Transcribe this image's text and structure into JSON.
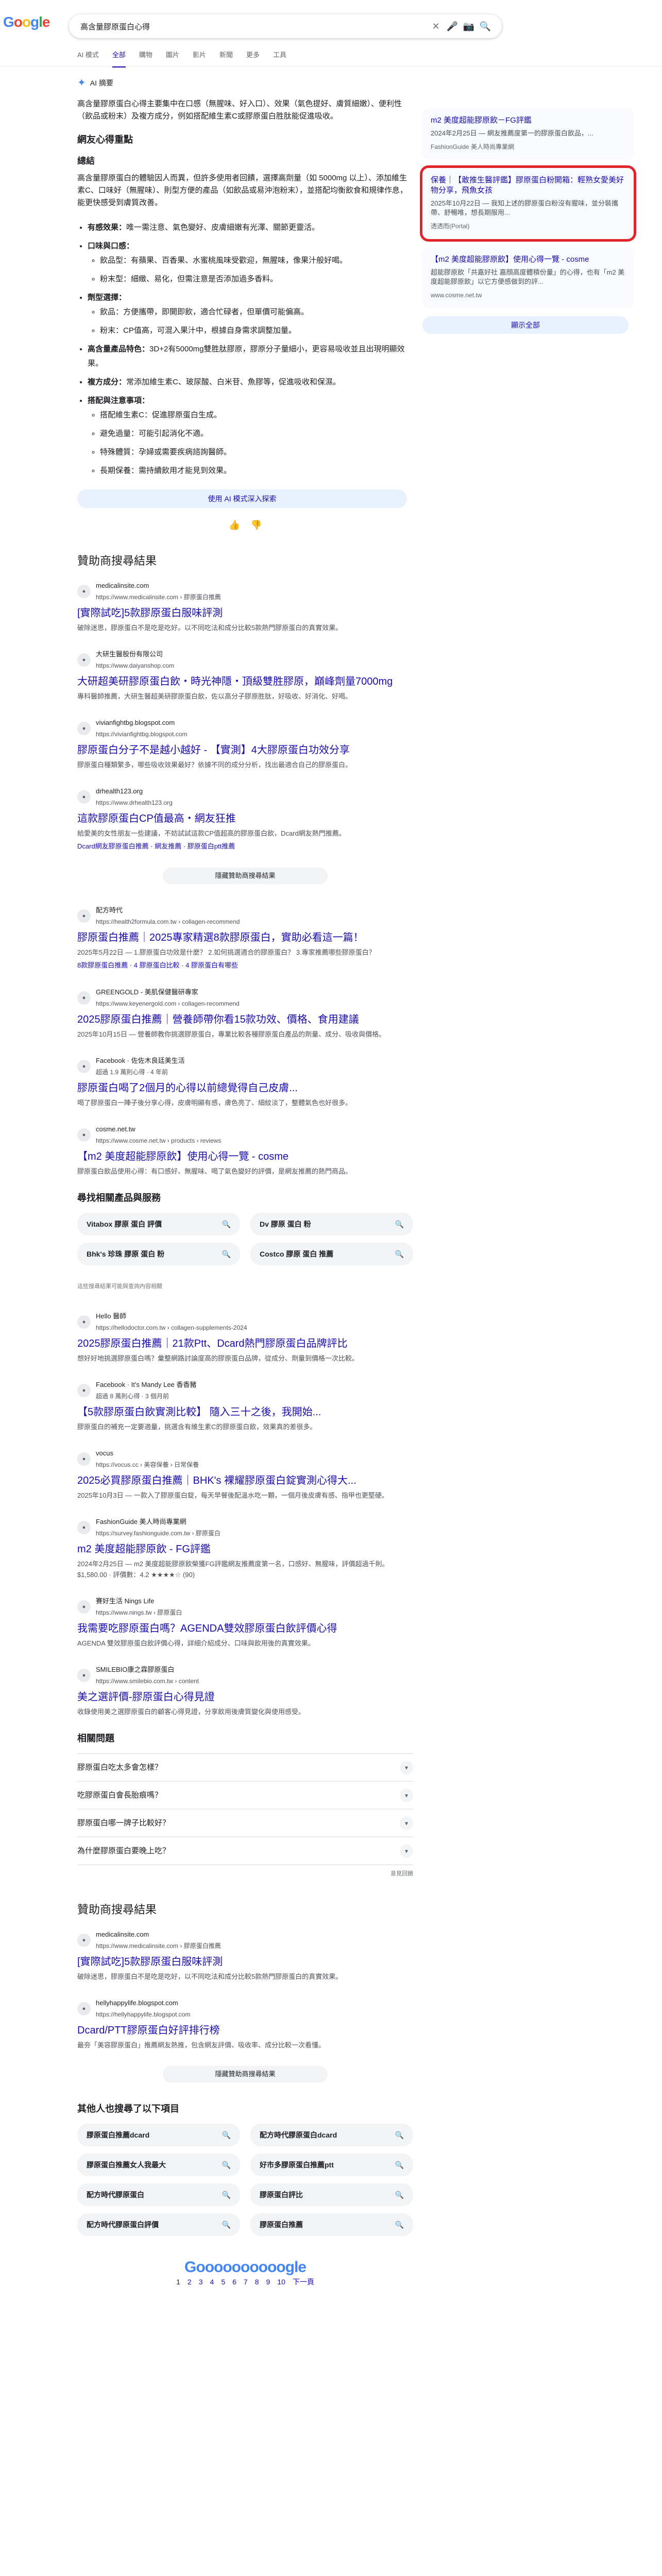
{
  "search": {
    "query": "高含量膠原蛋白心得"
  },
  "logo": [
    "G",
    "o",
    "o",
    "g",
    "l",
    "e"
  ],
  "tabs": [
    "AI 模式",
    "全部",
    "購物",
    "圖片",
    "影片",
    "新聞",
    "更多",
    "工具"
  ],
  "ai": {
    "label": "AI 摘要",
    "intro": "高含量膠原蛋白心得主要集中在口感（無腥味、好入口）、效果（氣色提好、膚質細嫩）、便利性（飲品或粉末）及複方成分，例如搭配維生素C或膠原蛋白胜肽能促進吸收。",
    "section_title": "網友心得重點",
    "summary_title": "總結",
    "summary": "高含量膠原蛋白的體驗因人而異，但許多使用者回饋，選擇高劑量（如 5000mg 以上）、添加維生素C、口味好（無腥味）、則型方便的產品（如飲品或易沖泡粉末），並搭配均衡飲食和規律作息，能更快感受到膚質改善。",
    "bullets": [
      {
        "title": "有感效果：",
        "text": "唯一需注意、氣色變好、皮膚細嫩有光澤、關節更靈活。"
      },
      {
        "title": "口味與口感：",
        "text": ""
      },
      {
        "title": "劑型選擇：",
        "text": ""
      },
      {
        "title": "高含量產品特色：",
        "text": "3D+2有5000mg雙胜肽膠原，膠原分子量細小，更容易吸收並且出現明顯效果。"
      },
      {
        "title": "複方成分：",
        "text": "常添加維生素C、玻尿酸、白米苷、魚膠等，促進吸收和保濕。"
      },
      {
        "title": "搭配與注意事項：",
        "text": ""
      }
    ],
    "sub_bullets": [
      "飲品型：有蘋果、百香果、水蜜桃風味受歡迎，無腥味，像果汁般好喝。",
      "粉末型：細緻、易化，但需注意是否添加過多香料。",
      "飲品：方便攜帶，即開即飲，適合忙碌者，但單價可能偏高。",
      "粉末：CP值高，可混入果汁中，根據自身需求調整加量。",
      "搭配維生素C：促進膠原蛋白生成。",
      "避免過量：可能引起消化不適。",
      "特殊體質：孕婦或需要疾病諮詢醫師。",
      "長期保養：需持續飲用才能見到效果。"
    ],
    "more_button": "使用 AI 模式深入探索"
  },
  "sidecards": [
    {
      "title": "m2 美度超能膠原飲－FG評鑑",
      "desc": "2024年2月25日 — 網友推薦度第一的膠原蛋白飲品，...",
      "source": "FashionGuide 美人時尚專業網"
    },
    {
      "title": "保養｜【敢推生醫評鑑】膠原蛋白粉開箱：輕熟女愛美好物分享，飛魚女孩",
      "desc": "2025年10月22日 — 我知上述的膠原蛋白粉沒有腥味，並分裝攜帶、舒暢唯，想長期服用...",
      "source": "透透而(Portal)"
    },
    {
      "title": "【m2 美度超能膠原飲】使用心得一覽 - cosme",
      "desc": "超能膠原飲「共嘉好社 嘉顔高度體積份量」的心得，也有「m2 美度超能膠原飲」以它方便感做到的評...",
      "source": "www.cosme.net.tw"
    }
  ],
  "show_all": "顯示全部",
  "sponsored_head": "贊助商搜尋結果",
  "ads1": [
    {
      "site": "medicalinsite.com",
      "url": "https://www.medicalinsite.com › 膠原蛋白推薦",
      "title": "[實際試吃]5款膠原蛋白服味評測",
      "desc": "破除迷思，膠原蛋白不是吃是吃好。以不同吃法和成分比較5款熱門膠原蛋白的真實效果。"
    },
    {
      "site": "大研生醫股份有限公司",
      "url": "https://www.daiyanshop.com",
      "title": "大研超美研膠原蛋白飲・時光神隱・頂級雙胜膠原，巔峰劑量7000mg",
      "desc": "專科醫師推薦，大研生醫超美研膠原蛋白飲，佐以高分子膠原胜肽，好吸收、好消化、好喝。"
    },
    {
      "site": "vivianfightbg.blogspot.com",
      "url": "https://vivianfightbg.blogspot.com",
      "title": "膠原蛋白分子不是越小越好 - 【實測】4大膠原蛋白功效分享",
      "desc": "膠原蛋白種類繁多，哪些吸收效果最好？依據不同的成分分析，找出最適合自己的膠原蛋白。"
    },
    {
      "site": "drhealth123.org",
      "url": "https://www.drhealth123.org",
      "title": "這款膠原蛋白CP值最高・網友狂推",
      "desc": "給愛美的女性朋友一些建議，不妨試試這款CP值超高的膠原蛋白飲，Dcard網友熱門推薦。",
      "links": "Dcard網友膠原蛋白推薦 · 網友推薦 · 膠原蛋白ptt推薦"
    }
  ],
  "toggle_label": "隱藏贊助商搜尋結果",
  "organic1": [
    {
      "site": "配方時代",
      "url": "https://health2formula.com.tw › collagen-recommend",
      "title": "膠原蛋白推薦｜2025專家精選8款膠原蛋白，實助必看這一篇！",
      "desc": "2025年5月22日 — 1.膠原蛋白功效是什麼？ 2.如何挑選適合的膠原蛋白？ 3.專家推薦哪些膠原蛋白？",
      "links": "8款膠原蛋白推薦 · 4 膠原蛋白比較 · 4 膠原蛋白有哪些"
    },
    {
      "site": "GREENGOLD - 美肌保健醫研專家",
      "url": "https://www.keyenergold.com › collagen-recommend",
      "title": "2025膠原蛋白推薦｜營養師帶你看15款功效、價格、食用建議",
      "desc": "2025年10月15日 — 營養師教你挑選膠原蛋白，專業比較各種膠原蛋白產品的劑量、成分、吸收與價格。"
    },
    {
      "site": "Facebook · 佐佐木良廷美生活",
      "url": "超過 1.9 萬則心得 · 4 年前",
      "title": "膠原蛋白喝了2個月的心得以前總覺得自己皮膚...",
      "desc": "喝了膠原蛋白一陣子後分享心得，皮膚明顯有感，膚色亮了、細紋淡了，整體氣色也好很多。"
    },
    {
      "site": "cosme.net.tw",
      "url": "https://www.cosme.net.tw › products › reviews",
      "title": "【m2 美度超能膠原飲】使用心得一覽 - cosme",
      "desc": "膠原蛋白飲品使用心得：有口感好、無腥味、喝了氣色變好的評價，是網友推薦的熱門商品。"
    }
  ],
  "related_products_head": "尋找相關產品與服務",
  "related_products": [
    "Vitabox 膠原 蛋白 評價",
    "Dv 膠原 蛋白 粉",
    "Bhk's 珍珠 膠原 蛋白 粉",
    "Costco 膠原 蛋白 推薦"
  ],
  "ad_note": "這些搜尋結果可能與查詢內容相關",
  "organic2": [
    {
      "site": "Hello 醫師",
      "url": "https://hellodoctor.com.tw › collagen-supplements-2024",
      "title": "2025膠原蛋白推薦｜21款Ptt、Dcard熱門膠原蛋白品牌評比",
      "desc": "想好好地挑選膠原蛋白嗎？彙整網路討論度高的膠原蛋白品牌，從成分、劑量到價格一次比較。"
    },
    {
      "site": "Facebook · It's Mandy Lee 香香豬",
      "url": "超過 8 萬則心得 · 3 個月前",
      "title": "【5款膠原蛋白飲實測比較】 隨入三十之後，我開始...",
      "desc": "膠原蛋白的補充一定要適量，挑選含有維生素C的膠原蛋白飲，效果真的差很多。"
    },
    {
      "site": "vocus",
      "url": "https://vocus.cc › 美容保養 › 日常保養",
      "title": "2025必買膠原蛋白推薦｜BHK's 裸耀膠原蛋白錠實測心得大...",
      "desc": "2025年10月3日 — 一款入了膠原蛋白錠，每天早餐後配溫水吃一顆，一個月後皮膚有感、指甲也更堅硬。"
    },
    {
      "site": "FashionGuide 美人時尚專業網",
      "url": "https://survey.fashionguide.com.tw › 膠原蛋白",
      "title": "m2 美度超能膠原飲 - FG評鑑",
      "desc": "2024年2月25日 — m2 美度超能膠原飲榮獲FG評鑑網友推薦度第一名，口感好、無腥味，評價超過千則。",
      "rating": "$1,580.00 · 評價數：4.2 ★★★★☆ (90)"
    },
    {
      "site": "賽好生活 Nings Life",
      "url": "https://www.nings.tw › 膠原蛋白",
      "title": "我需要吃膠原蛋白嗎？AGENDA雙效膠原蛋白飲評價心得",
      "desc": "AGENDA 雙效膠原蛋白飲評價心得，詳細介紹成分、口味與飲用後的真實效果。"
    },
    {
      "site": "SMILEBIO康之霖膠原蛋白",
      "url": "https://www.smilebio.com.tw › content",
      "title": "美之選評價-膠原蛋白心得見證",
      "desc": "收錄使用美之選膠原蛋白的顧客心得見證，分享飲用後膚質變化與使用感受。"
    }
  ],
  "paa_head": "相關問題",
  "paa": [
    "膠原蛋白吃太多會怎樣？",
    "吃膠原蛋白會長胎痕嗎？",
    "膠原蛋白哪一牌子比較好？",
    "為什麼膠原蛋白要晚上吃？"
  ],
  "feedback": "意見回饋",
  "ads2": [
    {
      "site": "medicalinsite.com",
      "url": "https://www.medicalinsite.com › 膠原蛋白推薦",
      "title": "[實際試吃]5款膠原蛋白服味評測",
      "desc": "破除迷思，膠原蛋白不是吃是吃好，以不同吃法和成分比較5款熱門膠原蛋白的真實效果。"
    },
    {
      "site": "hellyhappylife.blogspot.com",
      "url": "https://hellyhappylife.blogspot.com",
      "title": "Dcard/PTT膠原蛋白好評排行榜",
      "desc": "最夯「美容膠原蛋白」推薦網友熱推，包含網友評價、吸收率、成分比較一次看懂。"
    }
  ],
  "also_searched_head": "其他人也搜尋了以下項目",
  "also_searched": [
    "膠原蛋白推薦dcard",
    "配方時代膠原蛋白dcard",
    "膠原蛋白推薦女人我最大",
    "好市多膠原蛋白推薦ptt",
    "配方時代膠原蛋白",
    "膠原蛋白評比",
    "配方時代膠原蛋白評價",
    "膠原蛋白推薦"
  ],
  "pager": {
    "logo": "Goooooooooogle",
    "pages": [
      "1",
      "2",
      "3",
      "4",
      "5",
      "6",
      "7",
      "8",
      "9",
      "10"
    ],
    "next": "下一頁"
  }
}
